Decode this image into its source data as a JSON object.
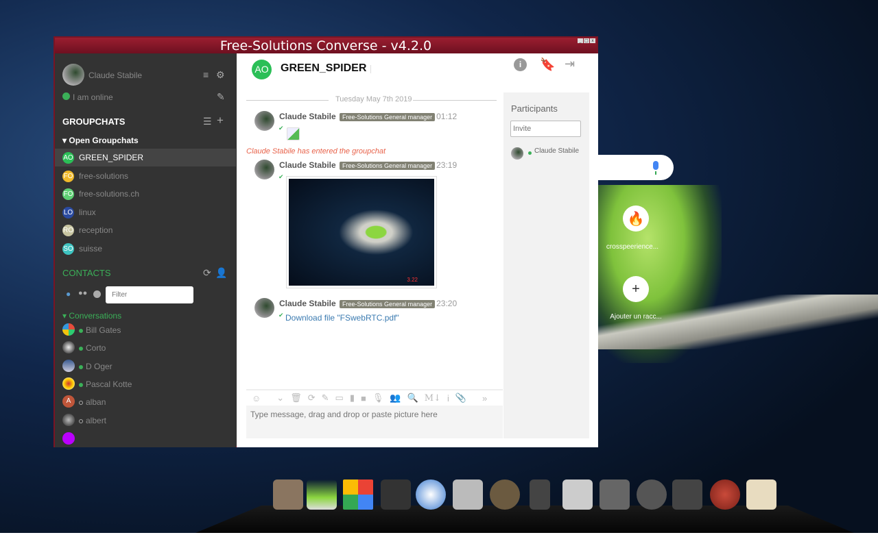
{
  "window": {
    "title": "Free-Solutions Converse - v4.2.0",
    "controls": [
      "_",
      "□",
      "x"
    ]
  },
  "profile": {
    "name": "Claude Stabile",
    "status": "I am online"
  },
  "groupchats": {
    "heading": "GROUPCHATS",
    "section": "Open Groupchats",
    "items": [
      {
        "initials": "AO",
        "name": "GREEN_SPIDER",
        "color": "#2bbf57",
        "active": true
      },
      {
        "initials": "FO",
        "name": "free-solutions",
        "color": "#f0b92a"
      },
      {
        "initials": "FO",
        "name": "free-solutions.ch",
        "color": "#5ecf73"
      },
      {
        "initials": "LO",
        "name": "linux",
        "color": "#2a4aa0"
      },
      {
        "initials": "RO",
        "name": "reception",
        "color": "#c7c4a0"
      },
      {
        "initials": "SO",
        "name": "suisse",
        "color": "#3ec3c0"
      }
    ]
  },
  "contacts": {
    "heading": "CONTACTS",
    "filter_placeholder": "Filter",
    "section": "Conversations",
    "items": [
      {
        "name": "Bill Gates",
        "online": true
      },
      {
        "name": "Corto",
        "online": true
      },
      {
        "name": "D Oger",
        "online": true
      },
      {
        "name": "Pascal Kotte",
        "online": true
      },
      {
        "name": "alban",
        "online": false,
        "initials": "A"
      },
      {
        "name": "albert",
        "online": false
      }
    ]
  },
  "chat": {
    "room_initials": "AO",
    "room_name": "GREEN_SPIDER",
    "date": "Tuesday May 7th 2019",
    "messages": [
      {
        "author": "Claude Stabile",
        "role": "Free-Solutions General manager",
        "time": "01:12"
      },
      {
        "author": "Claude Stabile",
        "role": "Free-Solutions General manager",
        "time": "23:19",
        "image_caption": "3.22"
      },
      {
        "author": "Claude Stabile",
        "role": "Free-Solutions General manager",
        "time": "23:20",
        "link": "Download file \"FSwebRTC.pdf\""
      }
    ],
    "event": "Claude Stabile has entered the groupchat",
    "input_placeholder": "Type message, drag and drop or paste picture here",
    "toolbar_markdown": "M↓"
  },
  "participants": {
    "heading": "Participants",
    "invite_placeholder": "Invite",
    "items": [
      {
        "name": "Claude Stabile"
      }
    ]
  },
  "desktop": {
    "shortcuts": [
      {
        "label": "crosspeerience..."
      },
      {
        "label": "Ajouter un racc..."
      }
    ]
  },
  "colors": {
    "accent": "#3bb058",
    "titlebar": "#8a1a2a",
    "event": "#e8624a"
  }
}
